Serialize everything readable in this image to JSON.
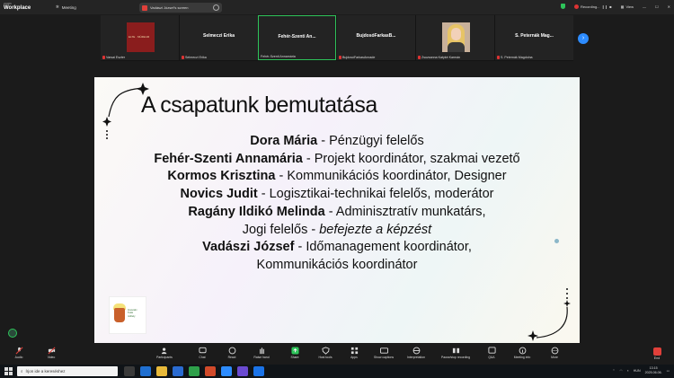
{
  "app": {
    "brand_small": "zoom",
    "brand": "Workplace",
    "meeting_label": "Meeting"
  },
  "share": {
    "label": "Vadászi József's screen"
  },
  "status": {
    "recording": "Recording...",
    "view": "View"
  },
  "participants": [
    {
      "name": "",
      "label": "Varsai Eszter",
      "muted": true,
      "thumb": "book-cover"
    },
    {
      "name": "Selmeczi Erika",
      "label": "Selmeczi Erika",
      "muted": true
    },
    {
      "name": "Fehér-Szenti An...",
      "label": "Fehér-Szenti Annamária",
      "muted": false,
      "active": true
    },
    {
      "name": "BujdosóFarkasB...",
      "label": "BujdosóFarkasAnnade",
      "muted": true
    },
    {
      "name": "",
      "label": "Zsuzsanna Katyké Karmán",
      "muted": true,
      "thumb": "photo"
    },
    {
      "name": "S. Peternák Mag...",
      "label": "S. Peternák Magdolna",
      "muted": true
    }
  ],
  "slide": {
    "title": "A csapatunk bemutatása",
    "members": [
      {
        "name": "Dora Mária",
        "role": " - Pénzügyi felelős"
      },
      {
        "name": "Fehér-Szenti Annamária",
        "role": " - Projekt koordinátor, szakmai vezető"
      },
      {
        "name": "Kormos Krisztina",
        "role": " - Kommunikációs koordinátor, Designer"
      },
      {
        "name": "Novics Judit",
        "role": " -  Logisztikai-technikai felelős, moderátor"
      },
      {
        "name": "Ragány Ildikó Melinda",
        "role": " - Adminisztratív munkatárs,",
        "role2": "Jogi felelős - ",
        "note": "befejezte a képzést"
      },
      {
        "name": "Vadászi József",
        "role": " - Időmanagement koordinátor,",
        "role2": "Kommunikációs koordinátor"
      }
    ],
    "logo_text": [
      "Innovatív",
      "Tudá",
      "műhely"
    ]
  },
  "toolbar": {
    "audio": "Audio",
    "video": "Video",
    "participants": "Participants",
    "participants_count": "14",
    "chat": "Chat",
    "react": "React",
    "raise_hand": "Raise hand",
    "share": "Share",
    "host_tools": "Host tools",
    "apps": "Apps",
    "captions": "Show captions",
    "interpretation": "Interpretation",
    "recording": "Pause/stop recording",
    "qa": "Q&A",
    "meeting_info": "Meeting info",
    "more": "More",
    "end": "End"
  },
  "taskbar": {
    "search_placeholder": "Írjon ide a kereséshez",
    "lang": "HUN",
    "time": "13:15",
    "date": "2025.06.06."
  },
  "colors": {
    "accent": "#2ec45a",
    "danger": "#e0403a",
    "blue": "#2d8cff"
  }
}
